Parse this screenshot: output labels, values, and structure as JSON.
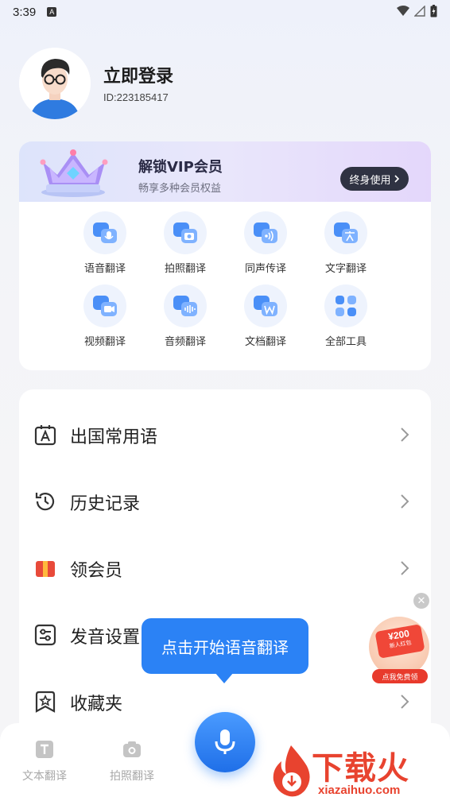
{
  "status_bar": {
    "time": "3:39",
    "badge": "A"
  },
  "profile": {
    "login_label": "立即登录",
    "user_id": "ID:223185417"
  },
  "vip": {
    "title": "解锁VIP会员",
    "subtitle": "畅享多种会员权益",
    "button_label": "终身使用"
  },
  "tools": [
    {
      "label": "语音翻译",
      "icon": "voice-translate-icon"
    },
    {
      "label": "拍照翻译",
      "icon": "camera-translate-icon"
    },
    {
      "label": "同声传译",
      "icon": "simultaneous-icon"
    },
    {
      "label": "文字翻译",
      "icon": "text-translate-icon"
    },
    {
      "label": "视频翻译",
      "icon": "video-translate-icon"
    },
    {
      "label": "音频翻译",
      "icon": "audio-translate-icon"
    },
    {
      "label": "文档翻译",
      "icon": "document-translate-icon"
    },
    {
      "label": "全部工具",
      "icon": "all-tools-icon"
    }
  ],
  "menu": [
    {
      "label": "出国常用语",
      "icon": "phrasebook-icon"
    },
    {
      "label": "历史记录",
      "icon": "history-icon"
    },
    {
      "label": "领会员",
      "icon": "gift-icon"
    },
    {
      "label": "发音设置",
      "icon": "settings-sliders-icon"
    },
    {
      "label": "收藏夹",
      "icon": "favorites-icon"
    }
  ],
  "tooltip": "点击开始语音翻译",
  "tabs": [
    {
      "label": "文本翻译",
      "icon": "text-tab-icon"
    },
    {
      "label": "拍照翻译",
      "icon": "camera-tab-icon"
    }
  ],
  "promo": {
    "amount": "¥200",
    "caption": "新人红包",
    "button": "点我免费领"
  },
  "watermark": {
    "brand": "下载火",
    "url": "xiazaihuo.com"
  },
  "colors": {
    "accent": "#2b82f5",
    "vip_button": "#2f3242",
    "promo_red": "#e83a2c"
  }
}
